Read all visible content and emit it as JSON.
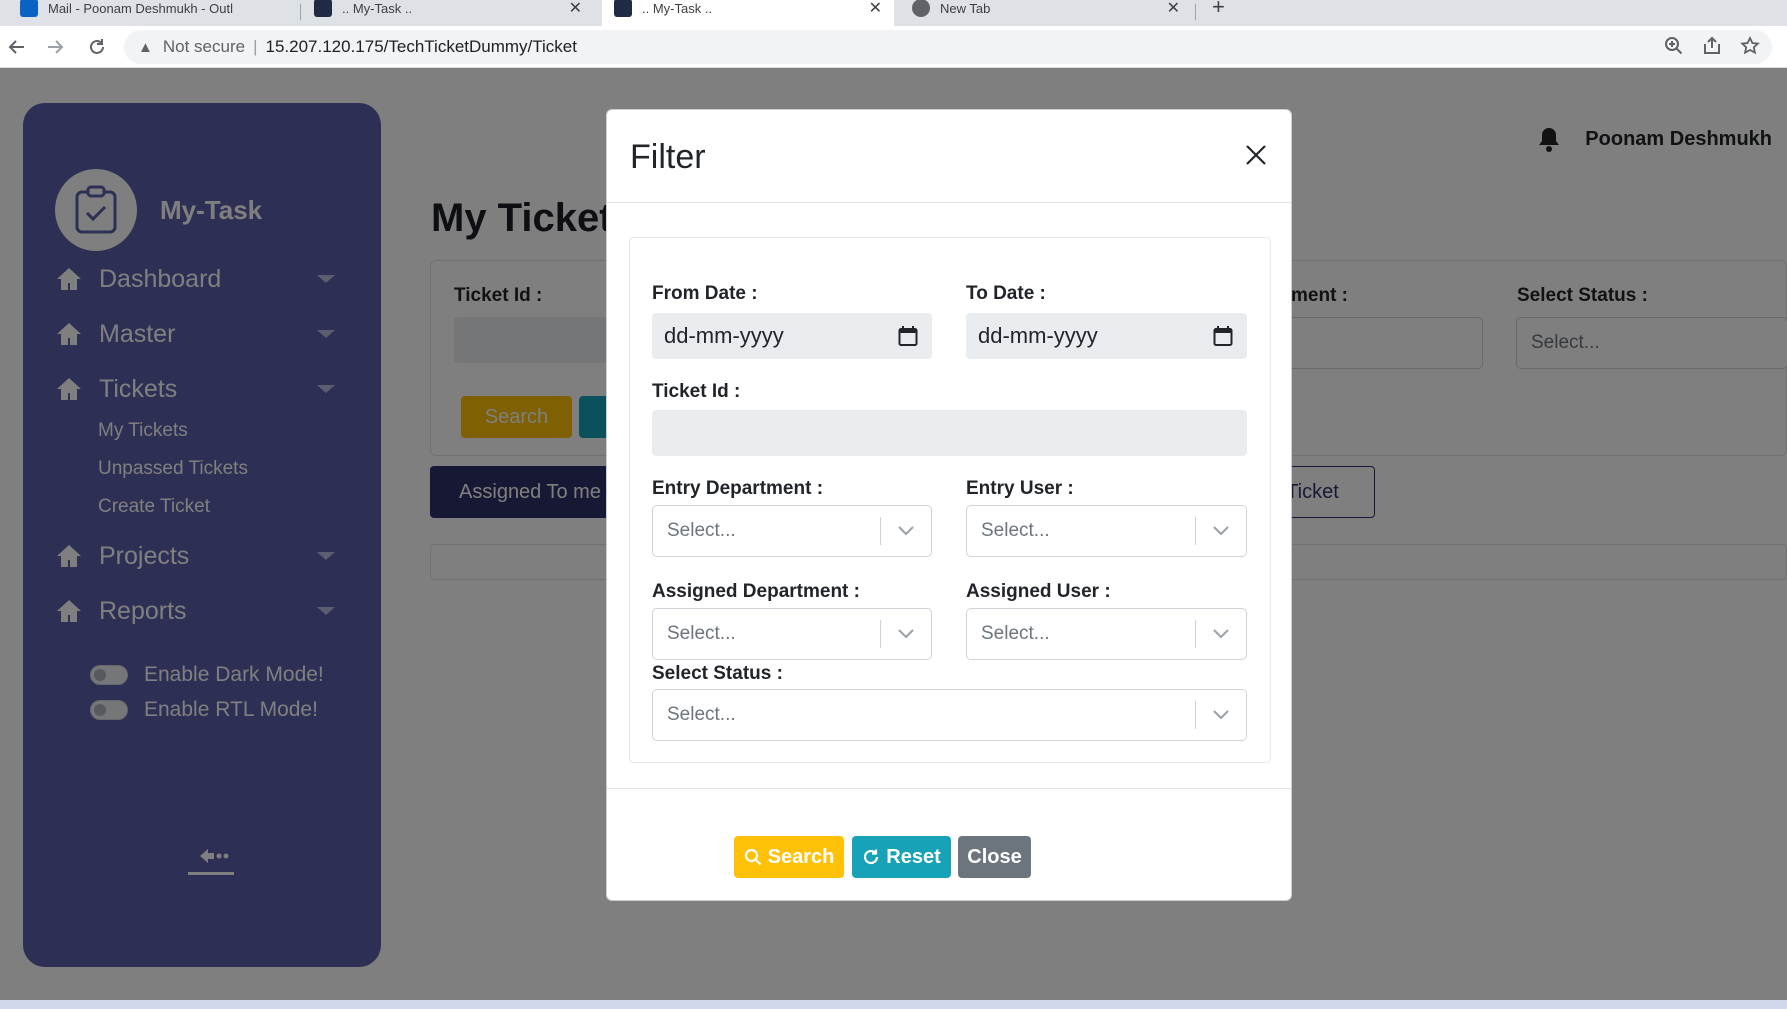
{
  "browser": {
    "tabs": [
      {
        "label": "Mail - Poonam Deshmukh - Outl",
        "close": "✕"
      },
      {
        "label": ".. My-Task ..",
        "close": "✕"
      },
      {
        "label": ".. My-Task ..",
        "close": "✕"
      },
      {
        "label": "New Tab",
        "close": "✕"
      }
    ],
    "new_tab": "+",
    "security_label": "Not secure",
    "url": "15.207.120.175/TechTicketDummy/Ticket"
  },
  "sidebar": {
    "app_name": "My-Task",
    "nav": [
      {
        "label": "Dashboard"
      },
      {
        "label": "Master"
      },
      {
        "label": "Tickets"
      },
      {
        "label": "Projects"
      },
      {
        "label": "Reports"
      }
    ],
    "ticket_sub": [
      "My Tickets",
      "Unpassed Tickets",
      "Create Ticket"
    ],
    "dark_mode_label": "Enable Dark Mode!",
    "rtl_mode_label": "Enable RTL Mode!"
  },
  "header": {
    "user_name": "Poonam Deshmukh"
  },
  "page": {
    "title": "My Ticket",
    "ticket_id_label": "Ticket Id :",
    "department_label": "ment :",
    "status_label": "Select Status :",
    "select_placeholder": "Select...",
    "search_label": "Search",
    "tab_assigned": "Assigned To me",
    "tab_ticket": "Ticket"
  },
  "modal": {
    "title": "Filter",
    "from_date_label": "From Date :",
    "to_date_label": "To Date :",
    "date_placeholder": "dd-mm-yyyy",
    "ticket_id_label": "Ticket Id :",
    "entry_department_label": "Entry Department :",
    "entry_user_label": "Entry User :",
    "assigned_department_label": "Assigned Department :",
    "assigned_user_label": "Assigned User :",
    "status_label": "Select Status :",
    "select_placeholder": "Select...",
    "search_button": "Search",
    "reset_button": "Reset",
    "close_button": "Close"
  },
  "colors": {
    "sidebar": "#5a5fa8",
    "search_btn": "#ffc107",
    "reset_btn": "#17a2b8",
    "close_btn": "#6c757d",
    "assigned_tab": "#2f3368"
  }
}
